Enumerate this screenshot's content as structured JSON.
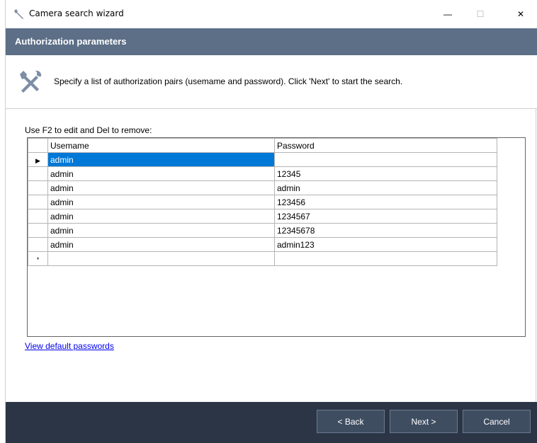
{
  "window": {
    "title": "Camera search wizard",
    "minimize": "—",
    "maximize": "☐",
    "close": "✕"
  },
  "header": {
    "title": "Authorization parameters"
  },
  "description": {
    "text": "Specify a list of authorization pairs (usemame and password). Click 'Next' to start the search."
  },
  "hint": "Use F2 to edit and Del to remove:",
  "grid": {
    "columns": [
      "Usemame",
      "Password"
    ],
    "rows": [
      {
        "user": "admin",
        "pass": ""
      },
      {
        "user": "admin",
        "pass": "12345"
      },
      {
        "user": "admin",
        "pass": "admin"
      },
      {
        "user": "admin",
        "pass": "123456"
      },
      {
        "user": "admin",
        "pass": "1234567"
      },
      {
        "user": "admin",
        "pass": "12345678"
      },
      {
        "user": "admin",
        "pass": "admin123"
      }
    ],
    "current_row_marker": "▶",
    "new_row_marker": "*"
  },
  "link": "View default passwords",
  "buttons": {
    "back": "< Back",
    "next": "Next >",
    "cancel": "Cancel"
  },
  "colors": {
    "header": "#5c6f87",
    "footer": "#2b3546",
    "selection": "#0078d7"
  }
}
